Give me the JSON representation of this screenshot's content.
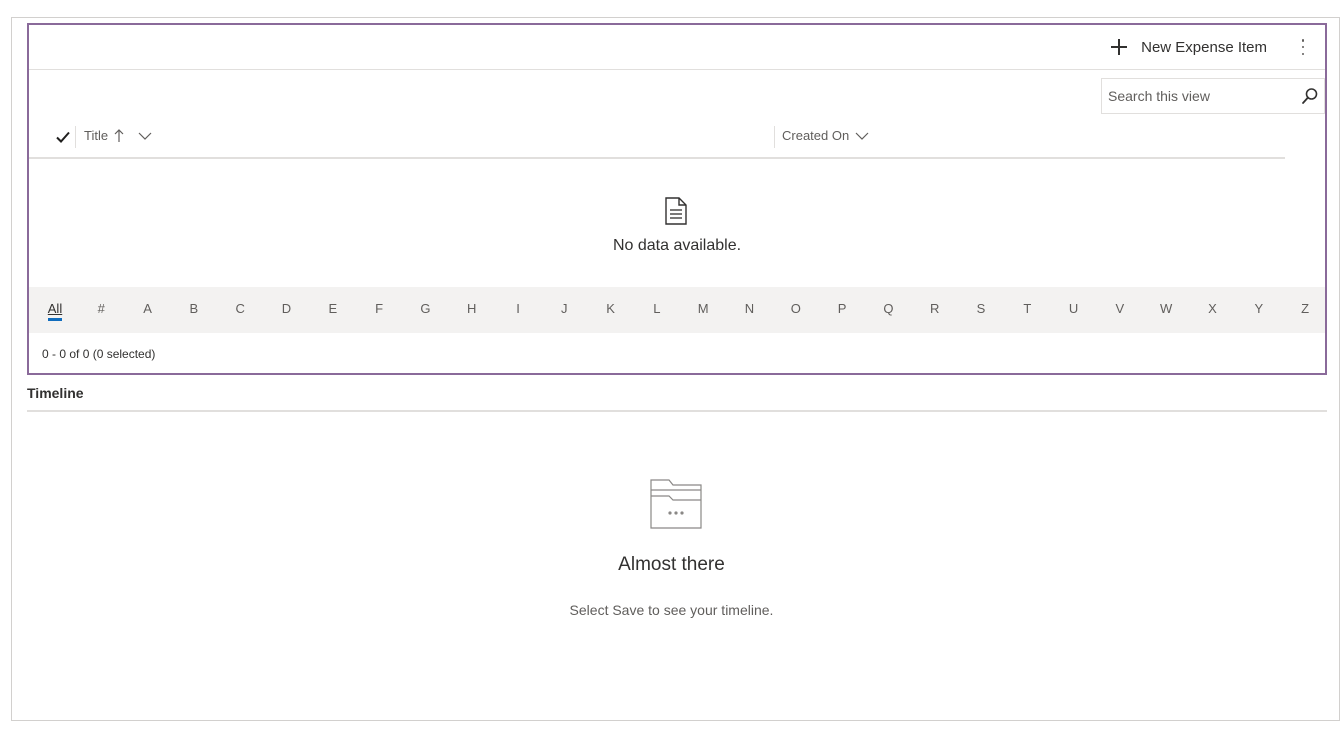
{
  "commandbar": {
    "new_label": "New Expense Item"
  },
  "search": {
    "placeholder": "Search this view"
  },
  "columns": {
    "title": "Title",
    "created_on": "Created On"
  },
  "grid": {
    "empty_text": "No data available.",
    "count_text": "0 - 0 of 0 (0 selected)"
  },
  "jumpbar": {
    "letters": [
      "All",
      "#",
      "A",
      "B",
      "C",
      "D",
      "E",
      "F",
      "G",
      "H",
      "I",
      "J",
      "K",
      "L",
      "M",
      "N",
      "O",
      "P",
      "Q",
      "R",
      "S",
      "T",
      "U",
      "V",
      "W",
      "X",
      "Y",
      "Z"
    ],
    "active": "All"
  },
  "timeline": {
    "label": "Timeline",
    "heading": "Almost there",
    "message": "Select Save to see your timeline."
  },
  "colors": {
    "focus_border": "#8a6a9a",
    "accent": "#0f6cbd"
  }
}
